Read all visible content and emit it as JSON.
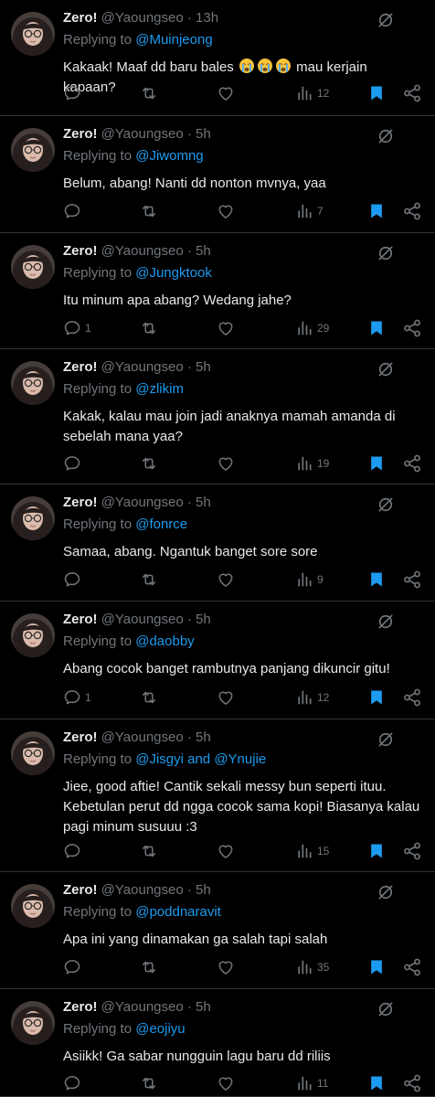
{
  "colors": {
    "background": "#000000",
    "text": "#e7e9ea",
    "muted": "#71767b",
    "link": "#1d9bf0",
    "divider": "#2f3336",
    "bookmark_active": "#1d9bf0"
  },
  "icons": [
    "reply-icon",
    "retweet-icon",
    "like-icon",
    "views-icon",
    "bookmark-icon",
    "share-icon",
    "not-interested-icon",
    "loudly-crying-emoji"
  ],
  "tweets": [
    {
      "name": "Zero!",
      "handle": "@Yaoungseo",
      "dot": "·",
      "time": "13h",
      "replying_label": "Replying to",
      "mentions": "@Muinjeong",
      "text_before": "Kakaak! Maaf dd baru bales",
      "emoji_count": 3,
      "text_after": "mau kerjain kapaan?",
      "replies": "",
      "views": "12",
      "bookmarked": true
    },
    {
      "name": "Zero!",
      "handle": "@Yaoungseo",
      "dot": "·",
      "time": "5h",
      "replying_label": "Replying to",
      "mentions": "@Jiwomng",
      "text": "Belum, abang! Nanti dd nonton mvnya, yaa",
      "replies": "",
      "views": "7",
      "bookmarked": true
    },
    {
      "name": "Zero!",
      "handle": "@Yaoungseo",
      "dot": "·",
      "time": "5h",
      "replying_label": "Replying to",
      "mentions": "@Jungktook",
      "text": "Itu minum apa abang? Wedang jahe?",
      "replies": "1",
      "views": "29",
      "bookmarked": true
    },
    {
      "name": "Zero!",
      "handle": "@Yaoungseo",
      "dot": "·",
      "time": "5h",
      "replying_label": "Replying to",
      "mentions": "@zlikim",
      "text": "Kakak, kalau mau join jadi anaknya mamah amanda di sebelah mana yaa?",
      "replies": "",
      "views": "19",
      "bookmarked": true
    },
    {
      "name": "Zero!",
      "handle": "@Yaoungseo",
      "dot": "·",
      "time": "5h",
      "replying_label": "Replying to",
      "mentions": "@fonrce",
      "text": "Samaa, abang. Ngantuk banget sore sore",
      "replies": "",
      "views": "9",
      "bookmarked": true
    },
    {
      "name": "Zero!",
      "handle": "@Yaoungseo",
      "dot": "·",
      "time": "5h",
      "replying_label": "Replying to",
      "mentions": "@daobby",
      "text": "Abang cocok banget rambutnya panjang dikuncir gitu!",
      "replies": "1",
      "views": "12",
      "bookmarked": true
    },
    {
      "name": "Zero!",
      "handle": "@Yaoungseo",
      "dot": "·",
      "time": "5h",
      "replying_label": "Replying to",
      "mentions": "@Jisgyi",
      "and_label": "and",
      "mentions2": "@Ynujie",
      "text": "Jiee, good aftie! Cantik sekali messy bun seperti ituu. Kebetulan perut dd ngga cocok sama kopi! Biasanya kalau pagi minum susuuu :3",
      "replies": "",
      "views": "15",
      "bookmarked": true
    },
    {
      "name": "Zero!",
      "handle": "@Yaoungseo",
      "dot": "·",
      "time": "5h",
      "replying_label": "Replying to",
      "mentions": "@poddnaravit",
      "text": "Apa ini yang dinamakan ga salah tapi salah",
      "replies": "",
      "views": "35",
      "bookmarked": true
    },
    {
      "name": "Zero!",
      "handle": "@Yaoungseo",
      "dot": "·",
      "time": "5h",
      "replying_label": "Replying to",
      "mentions": "@eojiyu",
      "text": "Asiikk! Ga sabar nungguin lagu baru dd riliis",
      "replies": "",
      "views": "11",
      "bookmarked": true
    }
  ]
}
